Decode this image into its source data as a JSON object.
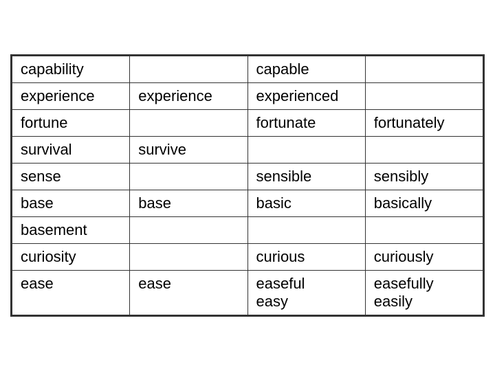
{
  "table": {
    "rows": [
      {
        "id": "row-capability",
        "cells": [
          "capability",
          "",
          "capable",
          ""
        ]
      },
      {
        "id": "row-experience",
        "cells": [
          "experience",
          "experience",
          "experienced",
          ""
        ]
      },
      {
        "id": "row-fortune",
        "cells": [
          "fortune",
          "",
          "fortunate",
          "fortunately"
        ]
      },
      {
        "id": "row-survival",
        "cells": [
          "survival",
          "survive",
          "",
          ""
        ]
      },
      {
        "id": "row-sense",
        "cells": [
          "sense",
          "",
          "sensible",
          "sensibly"
        ]
      },
      {
        "id": "row-base",
        "cells": [
          "base",
          "base",
          "basic",
          "basically"
        ]
      },
      {
        "id": "row-basement",
        "cells": [
          "basement",
          "",
          "",
          ""
        ]
      },
      {
        "id": "row-curiosity",
        "cells": [
          "curiosity",
          "",
          "curious",
          "curiously"
        ]
      },
      {
        "id": "row-ease",
        "cells": [
          "ease",
          "ease",
          "easeful\neasy",
          "easefully\neasily"
        ]
      }
    ]
  }
}
